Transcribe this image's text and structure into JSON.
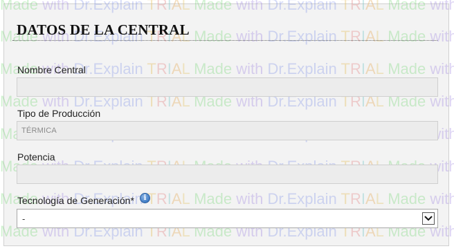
{
  "watermark": {
    "made": "Made",
    "with": " with ",
    "brand": "Dr.Explain",
    "trial": "TRIAL"
  },
  "section": {
    "title": "DATOS DE LA CENTRAL"
  },
  "fields": {
    "nombre_central": {
      "label": "Nombre Central",
      "value": ""
    },
    "tipo_produccion": {
      "label": "Tipo de Producción",
      "value": "TÉRMICA"
    },
    "potencia": {
      "label": "Potencia",
      "value": ""
    },
    "tecnologia_generacion": {
      "label": "Tecnología de Generación*",
      "selected": "-",
      "info_icon": "info-icon"
    }
  }
}
